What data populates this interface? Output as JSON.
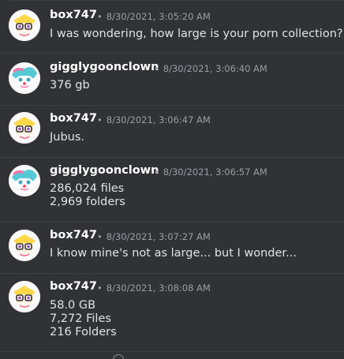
{
  "messages": [
    {
      "author": "box747",
      "avatar": "box747-avatar-icon",
      "timestamp": "8/30/2021, 3:05:20 AM",
      "lines": [
        "I was wondering, how large is your porn collection?"
      ]
    },
    {
      "author": "gigglygoonclown",
      "avatar": "gigglygoonclown-avatar-icon",
      "timestamp": "8/30/2021, 3:06:40 AM",
      "lines": [
        "376 gb"
      ]
    },
    {
      "author": "box747",
      "avatar": "box747-avatar-icon",
      "timestamp": "8/30/2021, 3:06:47 AM",
      "lines": [
        "Jubus."
      ]
    },
    {
      "author": "gigglygoonclown",
      "avatar": "gigglygoonclown-avatar-icon",
      "timestamp": "8/30/2021, 3:06:57 AM",
      "lines": [
        "286,024 files",
        "2,969 folders"
      ]
    },
    {
      "author": "box747",
      "avatar": "box747-avatar-icon",
      "timestamp": "8/30/2021, 3:07:27 AM",
      "lines": [
        "I know mine's not as large... but I wonder..."
      ]
    },
    {
      "author": "box747",
      "avatar": "box747-avatar-icon",
      "timestamp": "8/30/2021, 3:08:08 AM",
      "lines": [
        "58.0 GB",
        "7,272 Files",
        "216 Folders"
      ]
    }
  ],
  "separator": "•",
  "colors": {
    "background": "#303236",
    "author": "#ffffff",
    "timestamp": "#9a9da3",
    "text": "#e1e2e4",
    "divider": "#3c3f44"
  }
}
